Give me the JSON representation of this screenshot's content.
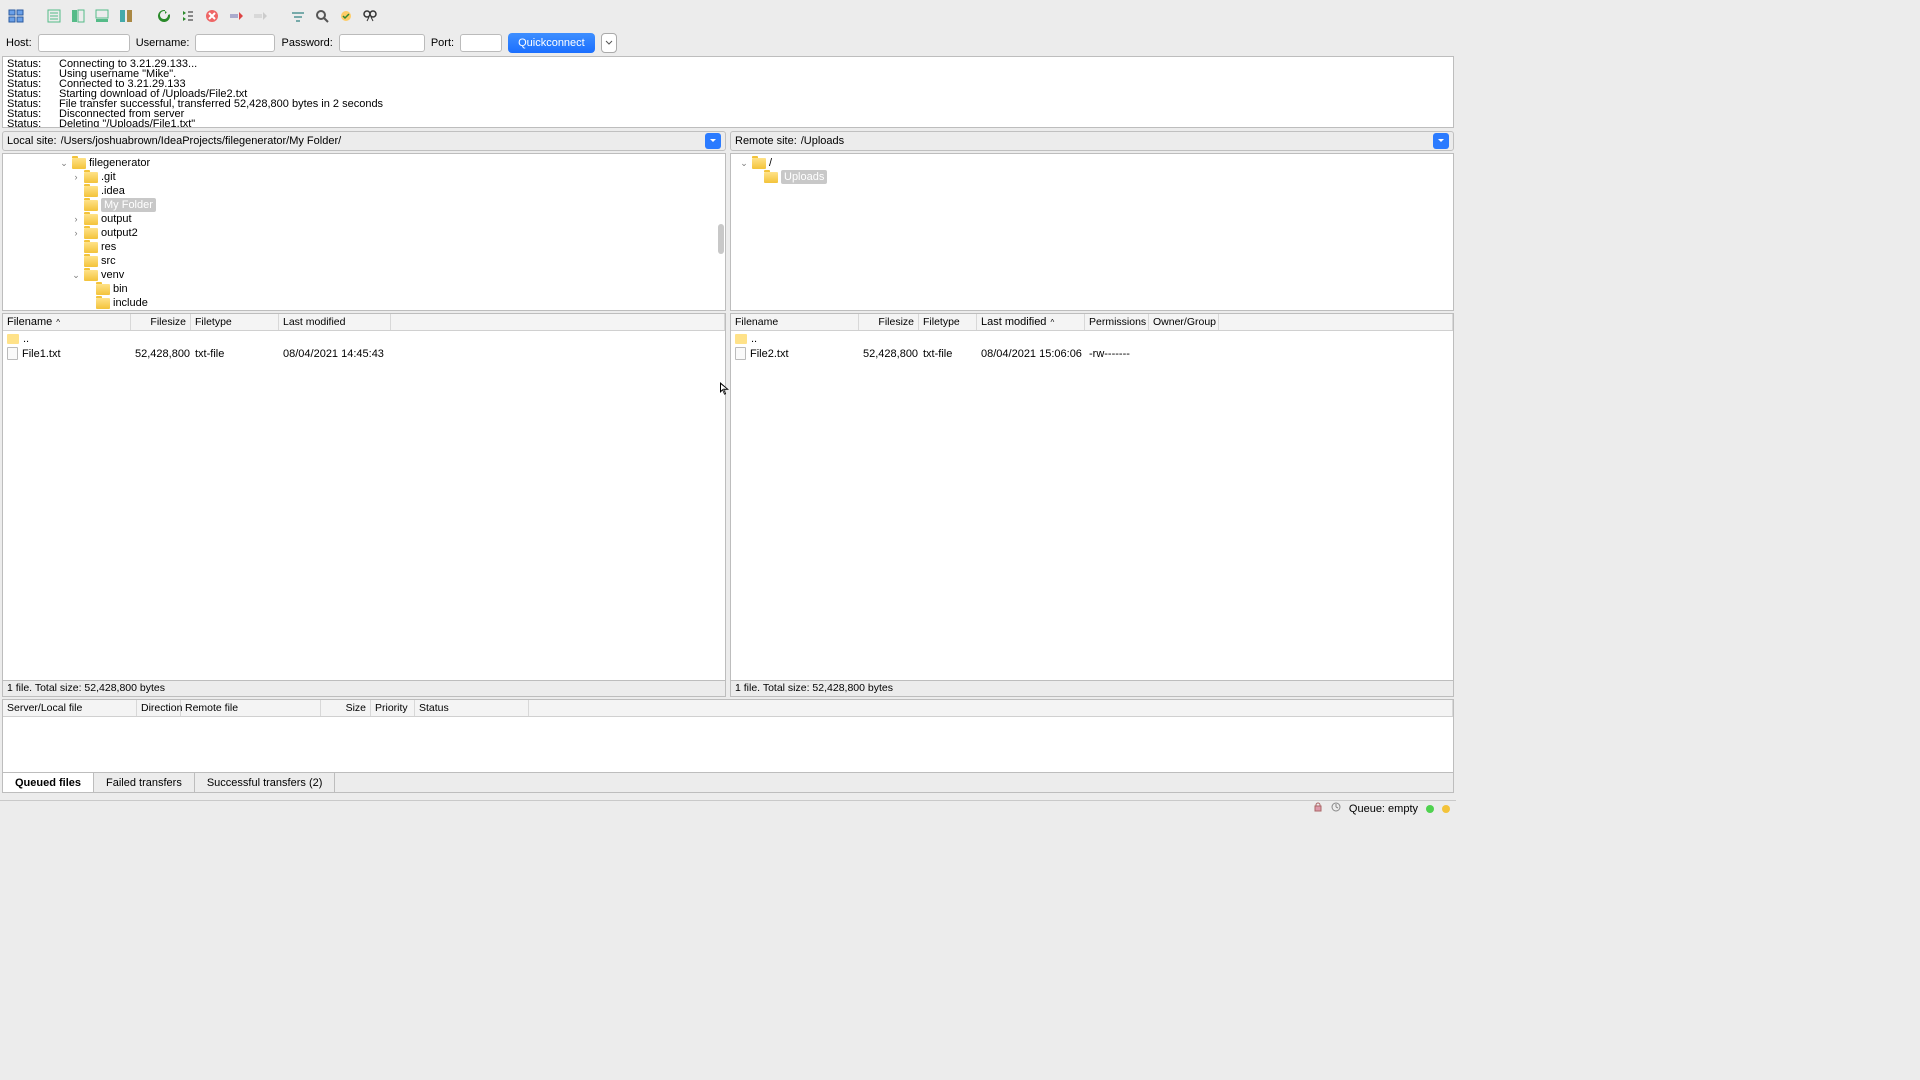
{
  "quickconnect": {
    "host_label": "Host:",
    "user_label": "Username:",
    "pass_label": "Password:",
    "port_label": "Port:",
    "button": "Quickconnect",
    "host": "",
    "user": "",
    "pass": "",
    "port": ""
  },
  "log": [
    {
      "label": "Status:",
      "msg": "Connecting to 3.21.29.133..."
    },
    {
      "label": "Status:",
      "msg": "Using username \"Mike\"."
    },
    {
      "label": "Status:",
      "msg": "Connected to 3.21.29.133"
    },
    {
      "label": "Status:",
      "msg": "Starting download of /Uploads/File2.txt"
    },
    {
      "label": "Status:",
      "msg": "File transfer successful, transferred 52,428,800 bytes in 2 seconds"
    },
    {
      "label": "Status:",
      "msg": "Disconnected from server"
    },
    {
      "label": "Status:",
      "msg": "Deleting \"/Uploads/File1.txt\""
    }
  ],
  "local": {
    "site_label": "Local site:",
    "path": "/Users/joshuabrown/IdeaProjects/filegenerator/My Folder/",
    "tree": [
      {
        "indent": 4,
        "toggle": "v",
        "name": "filegenerator"
      },
      {
        "indent": 5,
        "toggle": ">",
        "name": ".git"
      },
      {
        "indent": 5,
        "toggle": "",
        "name": ".idea"
      },
      {
        "indent": 5,
        "toggle": "",
        "name": "My Folder",
        "selected": true
      },
      {
        "indent": 5,
        "toggle": ">",
        "name": "output"
      },
      {
        "indent": 5,
        "toggle": ">",
        "name": "output2"
      },
      {
        "indent": 5,
        "toggle": "",
        "name": "res"
      },
      {
        "indent": 5,
        "toggle": "",
        "name": "src"
      },
      {
        "indent": 5,
        "toggle": "v",
        "name": "venv"
      },
      {
        "indent": 6,
        "toggle": "",
        "name": "bin"
      },
      {
        "indent": 6,
        "toggle": "",
        "name": "include"
      }
    ],
    "columns": {
      "name": "Filename",
      "size": "Filesize",
      "type": "Filetype",
      "mod": "Last modified"
    },
    "files": [
      {
        "name": "..",
        "parent": true
      },
      {
        "name": "File1.txt",
        "size": "52,428,800",
        "type": "txt-file",
        "mod": "08/04/2021 14:45:43"
      }
    ],
    "status": "1 file. Total size: 52,428,800 bytes"
  },
  "remote": {
    "site_label": "Remote site:",
    "path": "/Uploads",
    "tree": [
      {
        "indent": 0,
        "toggle": "v",
        "name": "/"
      },
      {
        "indent": 1,
        "toggle": "",
        "name": "Uploads",
        "selected": true
      }
    ],
    "columns": {
      "name": "Filename",
      "size": "Filesize",
      "type": "Filetype",
      "mod": "Last modified",
      "perm": "Permissions",
      "owner": "Owner/Group"
    },
    "files": [
      {
        "name": "..",
        "parent": true
      },
      {
        "name": "File2.txt",
        "size": "52,428,800",
        "type": "txt-file",
        "mod": "08/04/2021 15:06:06",
        "perm": "-rw-------",
        "owner": ""
      }
    ],
    "status": "1 file. Total size: 52,428,800 bytes"
  },
  "queue_columns": {
    "server": "Server/Local file",
    "dir": "Direction",
    "remote": "Remote file",
    "size": "Size",
    "prio": "Priority",
    "status": "Status"
  },
  "tabs": {
    "queued": "Queued files",
    "failed": "Failed transfers",
    "success": "Successful transfers (2)"
  },
  "footer": {
    "queue": "Queue: empty"
  }
}
